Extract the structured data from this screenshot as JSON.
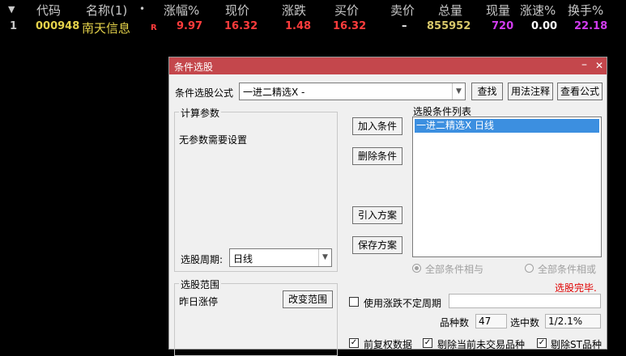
{
  "quote_table": {
    "headers": {
      "sort_icon": "▼",
      "code": "代码",
      "name": "名称(1)",
      "dot": "•",
      "change_pct": "涨幅%",
      "price": "现价",
      "change": "涨跌",
      "bid": "买价",
      "ask": "卖价",
      "volume": "总量",
      "current_volume": "现量",
      "speed": "涨速%",
      "turnover": "换手%"
    },
    "rows": [
      {
        "index": "1",
        "code": "000948",
        "name": "南天信息",
        "flag": "R",
        "change_pct": "9.97",
        "price": "16.32",
        "change": "1.48",
        "bid": "16.32",
        "ask": "–",
        "volume": "855952",
        "current_volume": "720",
        "speed": "0.00",
        "turnover": "22.18"
      }
    ]
  },
  "dialog": {
    "title": "条件选股",
    "minimize_icon": "–",
    "close_icon": "✕",
    "formula_label": "条件选股公式",
    "formula_value": "一进二精选X  -",
    "find_button": "查找",
    "usage_button": "用法注释",
    "view_formula_button": "查看公式",
    "params_group_title": "计算参数",
    "no_params_text": "无参数需要设置",
    "period_label": "选股周期:",
    "period_value": "日线",
    "add_condition_button": "加入条件",
    "delete_condition_button": "删除条件",
    "import_plan_button": "引入方案",
    "save_plan_button": "保存方案",
    "conditions_list_title": "选股条件列表",
    "conditions": [
      "一进二精选X  日线"
    ],
    "radio_and": "全部条件相与",
    "radio_or": "全部条件相或",
    "status_text": "选股完毕.",
    "range_group_title": "选股范围",
    "range_value": "昨日涨停",
    "change_range_button": "改变范围",
    "use_indefinite_period": "使用涨跌不定周期",
    "count_label": "品种数",
    "count_value": "47",
    "selected_label": "选中数",
    "selected_value": "1/2.1%",
    "checkbox_adjusted": "前复权数据",
    "checkbox_exclude_untraded": "剔除当前未交易品种",
    "checkbox_exclude_st": "剔除ST品种"
  },
  "colors": {
    "header_text": "#c8c8c8",
    "code_yellow": "#e5d24a",
    "red": "#ff3c3c",
    "volume_yellow": "#d8c86a",
    "purple": "#d23cf0",
    "white": "#ffffff",
    "titlebar": "#c4474c",
    "selection": "#3c8fe0",
    "status_red": "#e00000"
  }
}
